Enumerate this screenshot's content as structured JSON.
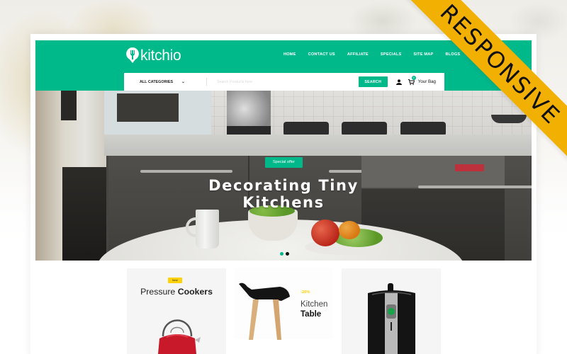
{
  "header": {
    "logo_text": "kitchio",
    "nav": [
      "HOME",
      "CONTACT US",
      "AFFILIATE",
      "SPECIALS",
      "SITE MAP",
      "BLOGS"
    ]
  },
  "search": {
    "category_label": "ALL CATEGORIES",
    "placeholder": "Search Products here",
    "button_label": "SEARCH",
    "cart_count": "0",
    "bag_label": "Your Bag"
  },
  "hero": {
    "badge": "Special offer",
    "title": "Decorating Tiny Kitchens",
    "slides": 2,
    "active_slide": 1
  },
  "banners": [
    {
      "badge": "New!",
      "title_light": "Pressure",
      "title_bold": "Cookers"
    },
    {
      "discount": "-20%",
      "title_light": "Kitchen",
      "title_bold": "Table"
    },
    {
      "title_light": "",
      "title_bold": ""
    }
  ],
  "ribbon": {
    "label": "RESPONSIVE"
  },
  "colors": {
    "accent": "#00b98b",
    "ribbon": "#f2b003",
    "badge_yellow": "#fdd20a"
  }
}
